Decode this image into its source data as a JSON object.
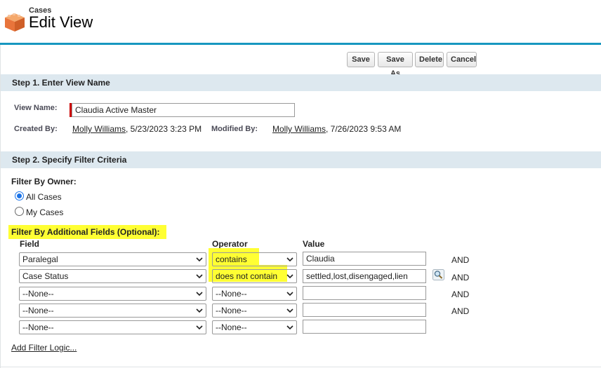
{
  "header": {
    "object_label": "Cases",
    "title": "Edit View",
    "icon": "case-box-icon"
  },
  "toolbar": {
    "save": "Save",
    "save_as": "Save As",
    "delete": "Delete",
    "cancel": "Cancel"
  },
  "step1": {
    "title": "Step 1. Enter View Name",
    "view_name_label": "View Name:",
    "view_name_value": "Claudia Active Master",
    "created_by_label": "Created By:",
    "created_by_user": "Molly Williams",
    "created_by_date": ", 5/23/2023 3:23 PM",
    "modified_by_label": "Modified By:",
    "modified_by_user": "Molly Williams",
    "modified_by_date": ", 7/26/2023 9:53 AM"
  },
  "step2": {
    "title": "Step 2. Specify Filter Criteria",
    "filter_owner_label": "Filter By Owner:",
    "owner_options": [
      "All Cases",
      "My Cases"
    ],
    "owner_selected": "All Cases",
    "additional_label": "Filter By Additional Fields (Optional):",
    "columns": {
      "field": "Field",
      "operator": "Operator",
      "value": "Value"
    },
    "rows": [
      {
        "field": "Paralegal",
        "operator": "contains",
        "value": "Claudia",
        "conj": "AND"
      },
      {
        "field": "Case Status",
        "operator": "does not contain",
        "value": "settled,lost,disengaged,lien",
        "conj": "AND"
      },
      {
        "field": "--None--",
        "operator": "--None--",
        "value": "",
        "conj": "AND"
      },
      {
        "field": "--None--",
        "operator": "--None--",
        "value": "",
        "conj": "AND"
      },
      {
        "field": "--None--",
        "operator": "--None--",
        "value": "",
        "conj": ""
      }
    ],
    "lookup_icon": "magnifier-lookup-icon",
    "add_filter_logic": "Add Filter Logic..."
  },
  "colors": {
    "accent_rule": "#1797c0",
    "section_bar": "#dde8ef",
    "highlight": "#ffff33",
    "required": "#cc0000",
    "icon_orange": "#e8743b"
  }
}
